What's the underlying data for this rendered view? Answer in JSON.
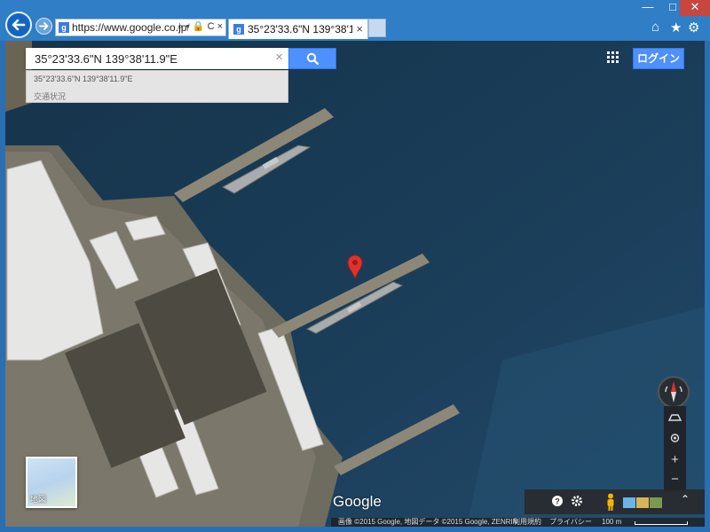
{
  "browser": {
    "url_host": "https://www.google.co.jp",
    "url_tail": "/",
    "address_tools": "⌕ ▾ 🔒 C ×",
    "tab_title": "35°23'33.6\"N 139°38'11....",
    "tab_close": "×",
    "window": {
      "min": "—",
      "max": "□",
      "close": "✕"
    },
    "right_icons": {
      "home": "⌂",
      "favorites": "★",
      "settings": "⚙"
    }
  },
  "search": {
    "value": "35°23'33.6\"N 139°38'11.9\"E",
    "clear": "×",
    "suggestions": [
      "35°23'33.6\"N 139°38'11.9\"E",
      "交通状況"
    ]
  },
  "header": {
    "login_label": "ログイン"
  },
  "minimap": {
    "label": "地図"
  },
  "logo": "Google",
  "controls": {
    "zoom_in": "+",
    "zoom_out": "−",
    "expand": "⌃"
  },
  "attribution": {
    "imagery": "画像 ©2015 Google, 地図データ ©2015 Google, ZENRIN",
    "terms": "利用規約",
    "privacy": "プライバシー",
    "scale": "100 m"
  },
  "colors": {
    "accent": "#4d90fe",
    "chrome": "#2f7ec6",
    "water": "#1a3a54",
    "pin": "#e0332c"
  }
}
